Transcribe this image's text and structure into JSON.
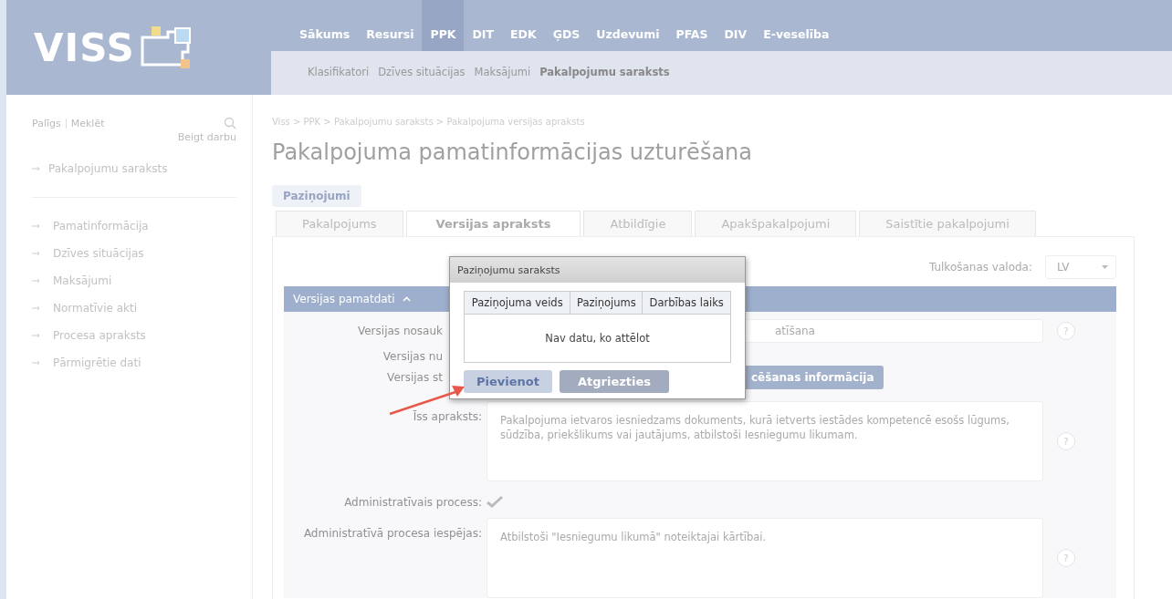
{
  "logo": {
    "text": "VISS"
  },
  "nav": [
    {
      "label": "Sākums",
      "selected": false
    },
    {
      "label": "Resursi",
      "selected": false
    },
    {
      "label": "PPK",
      "selected": true
    },
    {
      "label": "DIT",
      "selected": false
    },
    {
      "label": "EDK",
      "selected": false
    },
    {
      "label": "ĢDS",
      "selected": false
    },
    {
      "label": "Uzdevumi",
      "selected": false
    },
    {
      "label": "PFAS",
      "selected": false
    },
    {
      "label": "DIV",
      "selected": false
    },
    {
      "label": "E-veselība",
      "selected": false
    }
  ],
  "subnav": [
    {
      "label": "Klasifikatori",
      "selected": false
    },
    {
      "label": "Dzīves situācijas",
      "selected": false
    },
    {
      "label": "Maksājumi",
      "selected": false
    },
    {
      "label": "Pakalpojumu saraksts",
      "selected": true
    }
  ],
  "sidebar": {
    "links": [
      "Palīgs",
      "Meklēt"
    ],
    "logout": "Beigt darbu",
    "back": "Pakalpojumu saraksts",
    "items": [
      "Pamatinformācija",
      "Dzīves situācijas",
      "Maksājumi",
      "Normatīvie akti",
      "Procesa apraksts",
      "Pārmigrētie dati"
    ]
  },
  "breadcrumb": "Viss > PPK > Pakalpojumu saraksts > Pakalpojuma versijas apraksts",
  "title": "Pakalpojuma pamatinformācijas uzturēšana",
  "notices_button": "Paziņojumi",
  "tabs": [
    {
      "label": "Pakalpojums",
      "selected": false
    },
    {
      "label": "Versijas apraksts",
      "selected": true
    },
    {
      "label": "Atbildīgie",
      "selected": false
    },
    {
      "label": "Apakšpakalpojumi",
      "selected": false
    },
    {
      "label": "Saistītie pakalpojumi",
      "selected": false
    }
  ],
  "translation": {
    "label": "Tulkošanas valoda:",
    "value": "LV"
  },
  "section": {
    "title": "Versijas pamatdati",
    "expanded": true
  },
  "form": [
    {
      "kind": "text",
      "label": "Versijas nosauk",
      "covered": true,
      "value": "atīšana",
      "help": "?"
    },
    {
      "kind": "plain",
      "label": "Versijas nu",
      "covered": true
    },
    {
      "kind": "button",
      "label": "Versijas st",
      "covered": true,
      "button": "cēšanas informācija"
    },
    {
      "kind": "textarea",
      "label": "Īss apraksts:",
      "covered": false,
      "value": "Pakalpojuma ietvaros iesniedzams dokuments, kurā ietverts iestādes kompetencē esošs lūgums, sūdzība, priekšlikums vai jautājums, atbilstoši Iesniegumu likumam.",
      "help": "?"
    },
    {
      "kind": "check",
      "label": "Administratīvais process:",
      "covered": false,
      "checked": true
    },
    {
      "kind": "textarea",
      "label": "Administratīvā procesa iespējas:",
      "covered": false,
      "value": "Atbilstoši \"Iesniegumu likumā\" noteiktajai kārtībai.",
      "help": "?"
    }
  ],
  "dialog": {
    "title": "Paziņojumu saraksts",
    "columns": [
      "Paziņojuma veids",
      "Paziņojums",
      "Darbības laiks"
    ],
    "empty": "Nav datu, ko attēlot",
    "buttons": [
      {
        "label": "Pievienot",
        "kind": "secondary"
      },
      {
        "label": "Atgriezties",
        "kind": "primary"
      }
    ]
  }
}
